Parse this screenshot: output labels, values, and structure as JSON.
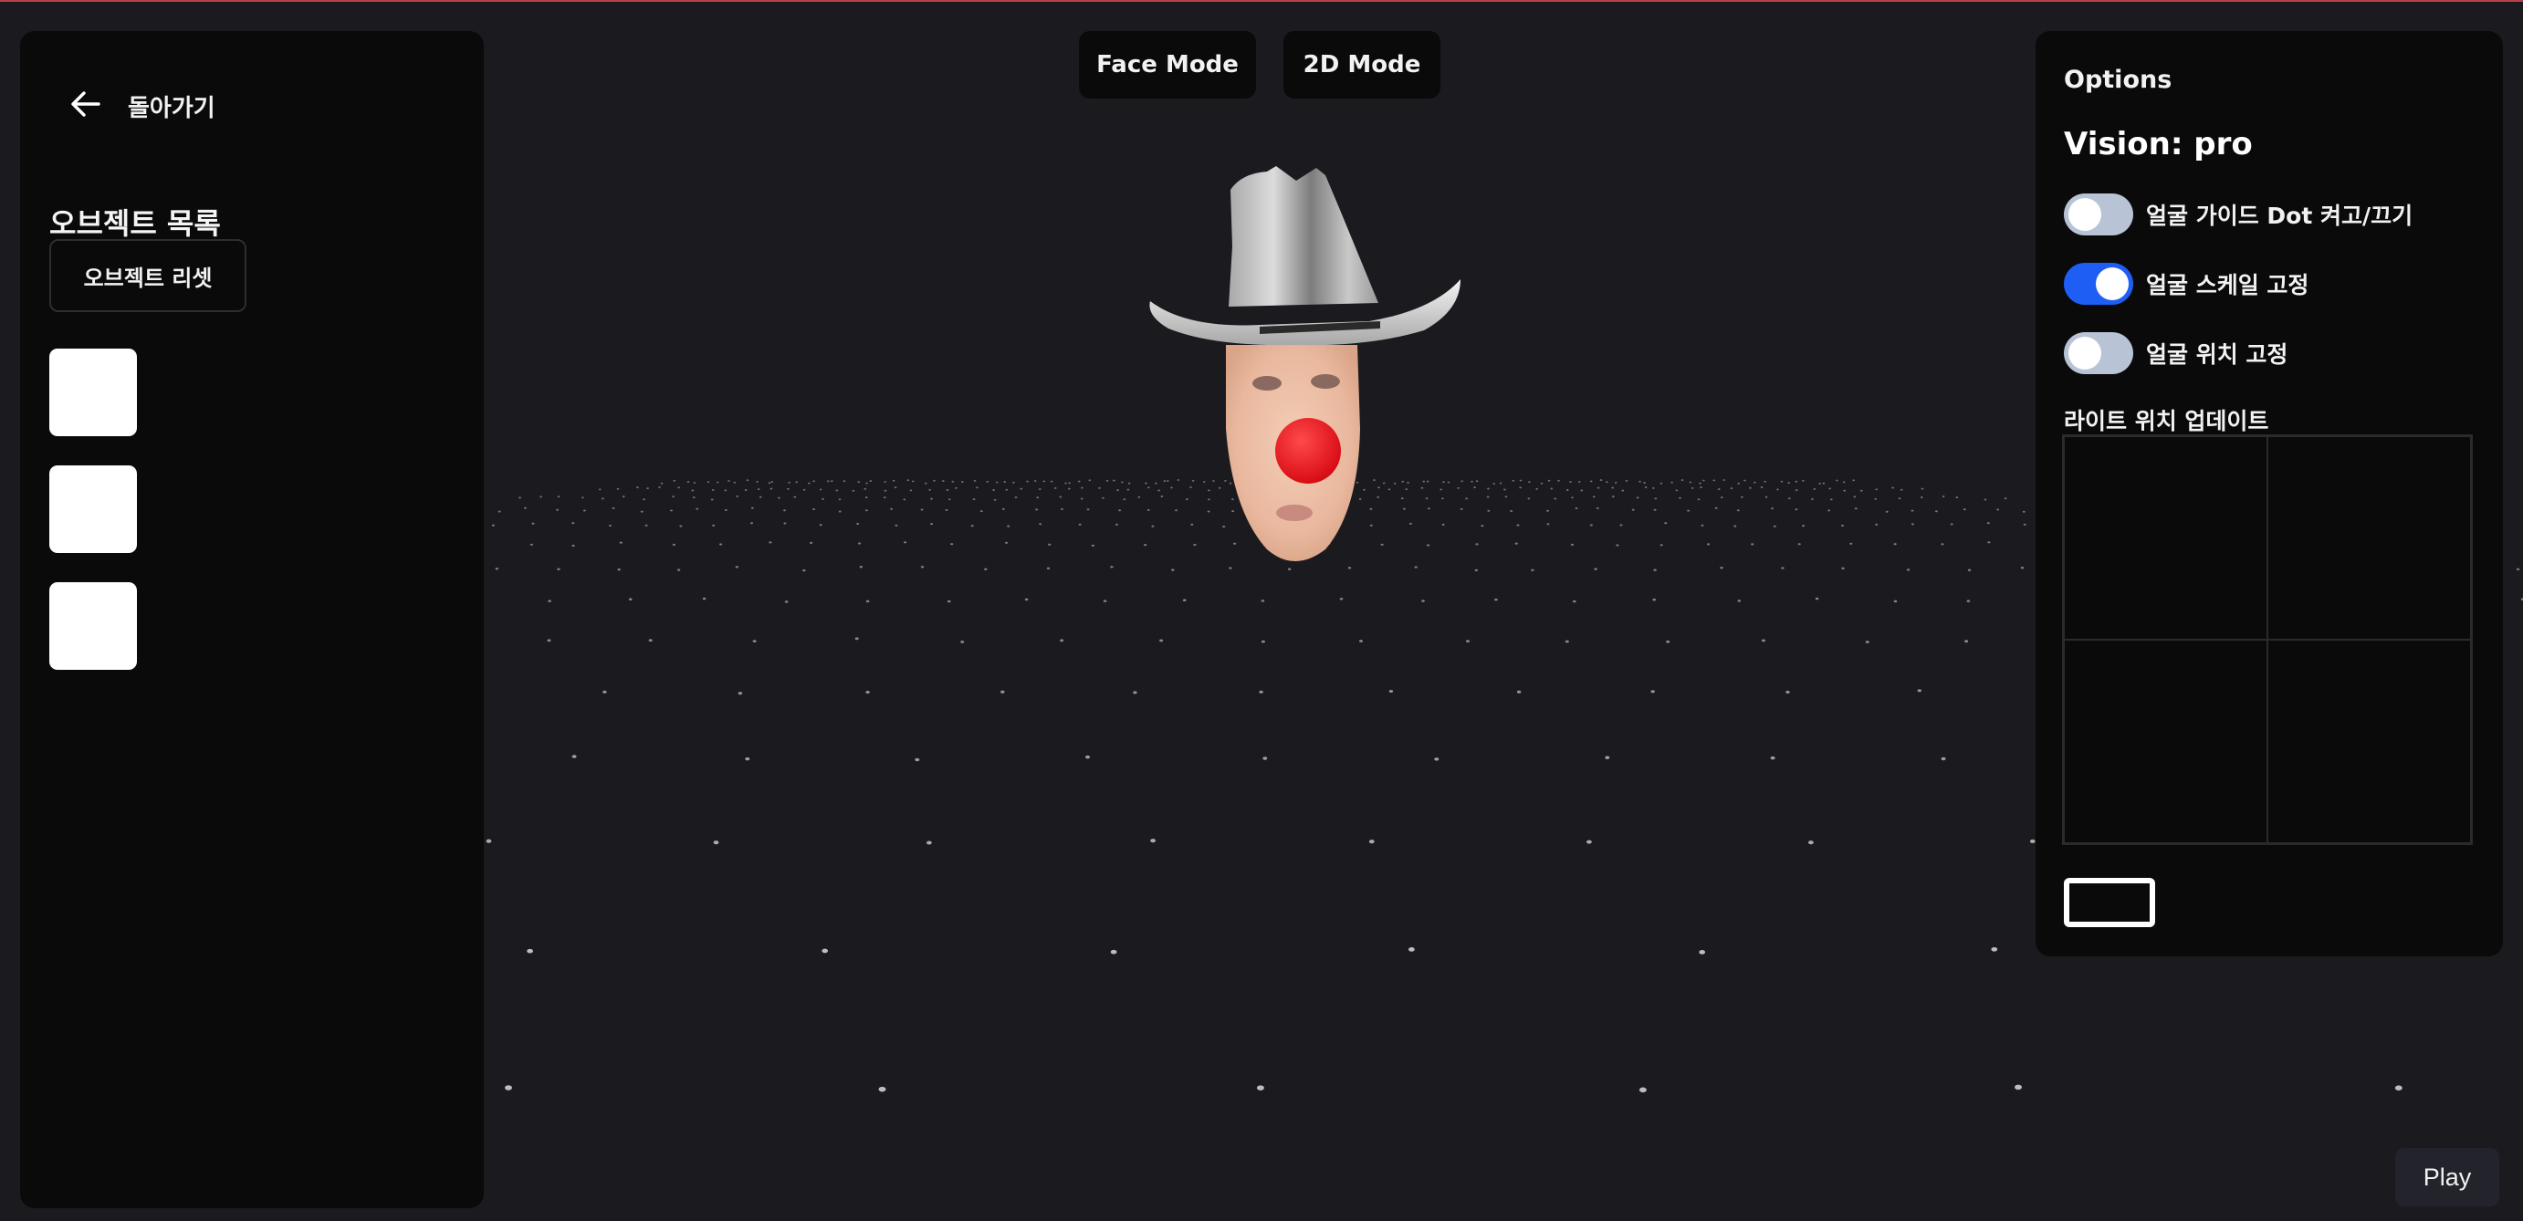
{
  "left_panel": {
    "back_label": "돌아가기",
    "back_icon": "arrow-left-icon",
    "objects_title": "오브젝트 목록",
    "reset_label": "오브젝트 리셋",
    "object_count": 3
  },
  "toolbar": {
    "face_mode_label": "Face Mode",
    "mode_2d_label": "2D Mode"
  },
  "options": {
    "title": "Options",
    "vision_label": "Vision: pro",
    "toggles": [
      {
        "label": "얼굴 가이드 Dot 켜고/끄기",
        "on": false
      },
      {
        "label": "얼굴 스케일 고정",
        "on": true
      },
      {
        "label": "얼굴 위치 고정",
        "on": false
      }
    ],
    "light_title": "라이트 위치 업데이트",
    "light_cells": 4
  },
  "play_label": "Play",
  "colors": {
    "background": "#1b1b1f",
    "panel": "#0a0a0a",
    "toggle_on": "#1e5ef5",
    "toggle_off": "#b8c3d6",
    "top_accent": "#b8404a",
    "nose": "#e8141c"
  }
}
